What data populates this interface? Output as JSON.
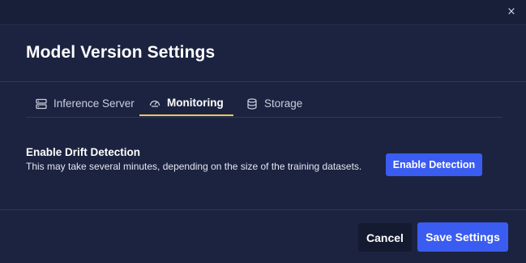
{
  "modal": {
    "title": "Model Version Settings",
    "close_label": "×"
  },
  "tabs": [
    {
      "label": "Inference Server",
      "icon": "server-icon",
      "active": false
    },
    {
      "label": "Monitoring",
      "icon": "gauge-icon",
      "active": true
    },
    {
      "label": "Storage",
      "icon": "database-icon",
      "active": false
    }
  ],
  "section": {
    "title": "Enable Drift Detection",
    "description": "This may take several minutes, depending on the size of the training datasets.",
    "button_label": "Enable Detection"
  },
  "footer": {
    "cancel_label": "Cancel",
    "save_label": "Save Settings"
  },
  "colors": {
    "background": "#1c2340",
    "accent": "#3b5cf0",
    "active_tab_underline": "#e8c860"
  }
}
